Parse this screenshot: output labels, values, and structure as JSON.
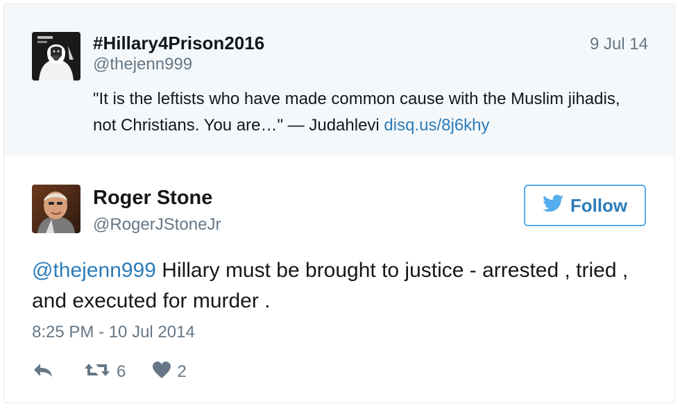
{
  "quoted_tweet": {
    "display_name": "#Hillary4Prison2016",
    "handle": "@thejenn999",
    "date": "9 Jul 14",
    "text_main": "\"It is the leftists who have made common cause with the Muslim jihadis, not Christians. You are…\" — Judahlevi ",
    "link_text": "disq.us/8j6khy"
  },
  "main_tweet": {
    "display_name": "Roger Stone",
    "handle": "@RogerJStoneJr",
    "follow_label": "Follow",
    "mention": "@thejenn999",
    "text_body": " Hillary must be brought to justice - arrested , tried , and executed for murder .",
    "timestamp": "8:25 PM - 10 Jul 2014",
    "retweet_count": "6",
    "like_count": "2"
  },
  "colors": {
    "link_blue": "#2b7bb9",
    "twitter_blue": "#55acee",
    "muted_gray": "#657786",
    "quoted_bg": "#f5f8fa"
  },
  "icons": [
    "reply-icon",
    "retweet-icon",
    "heart-icon",
    "twitter-bird-icon"
  ]
}
